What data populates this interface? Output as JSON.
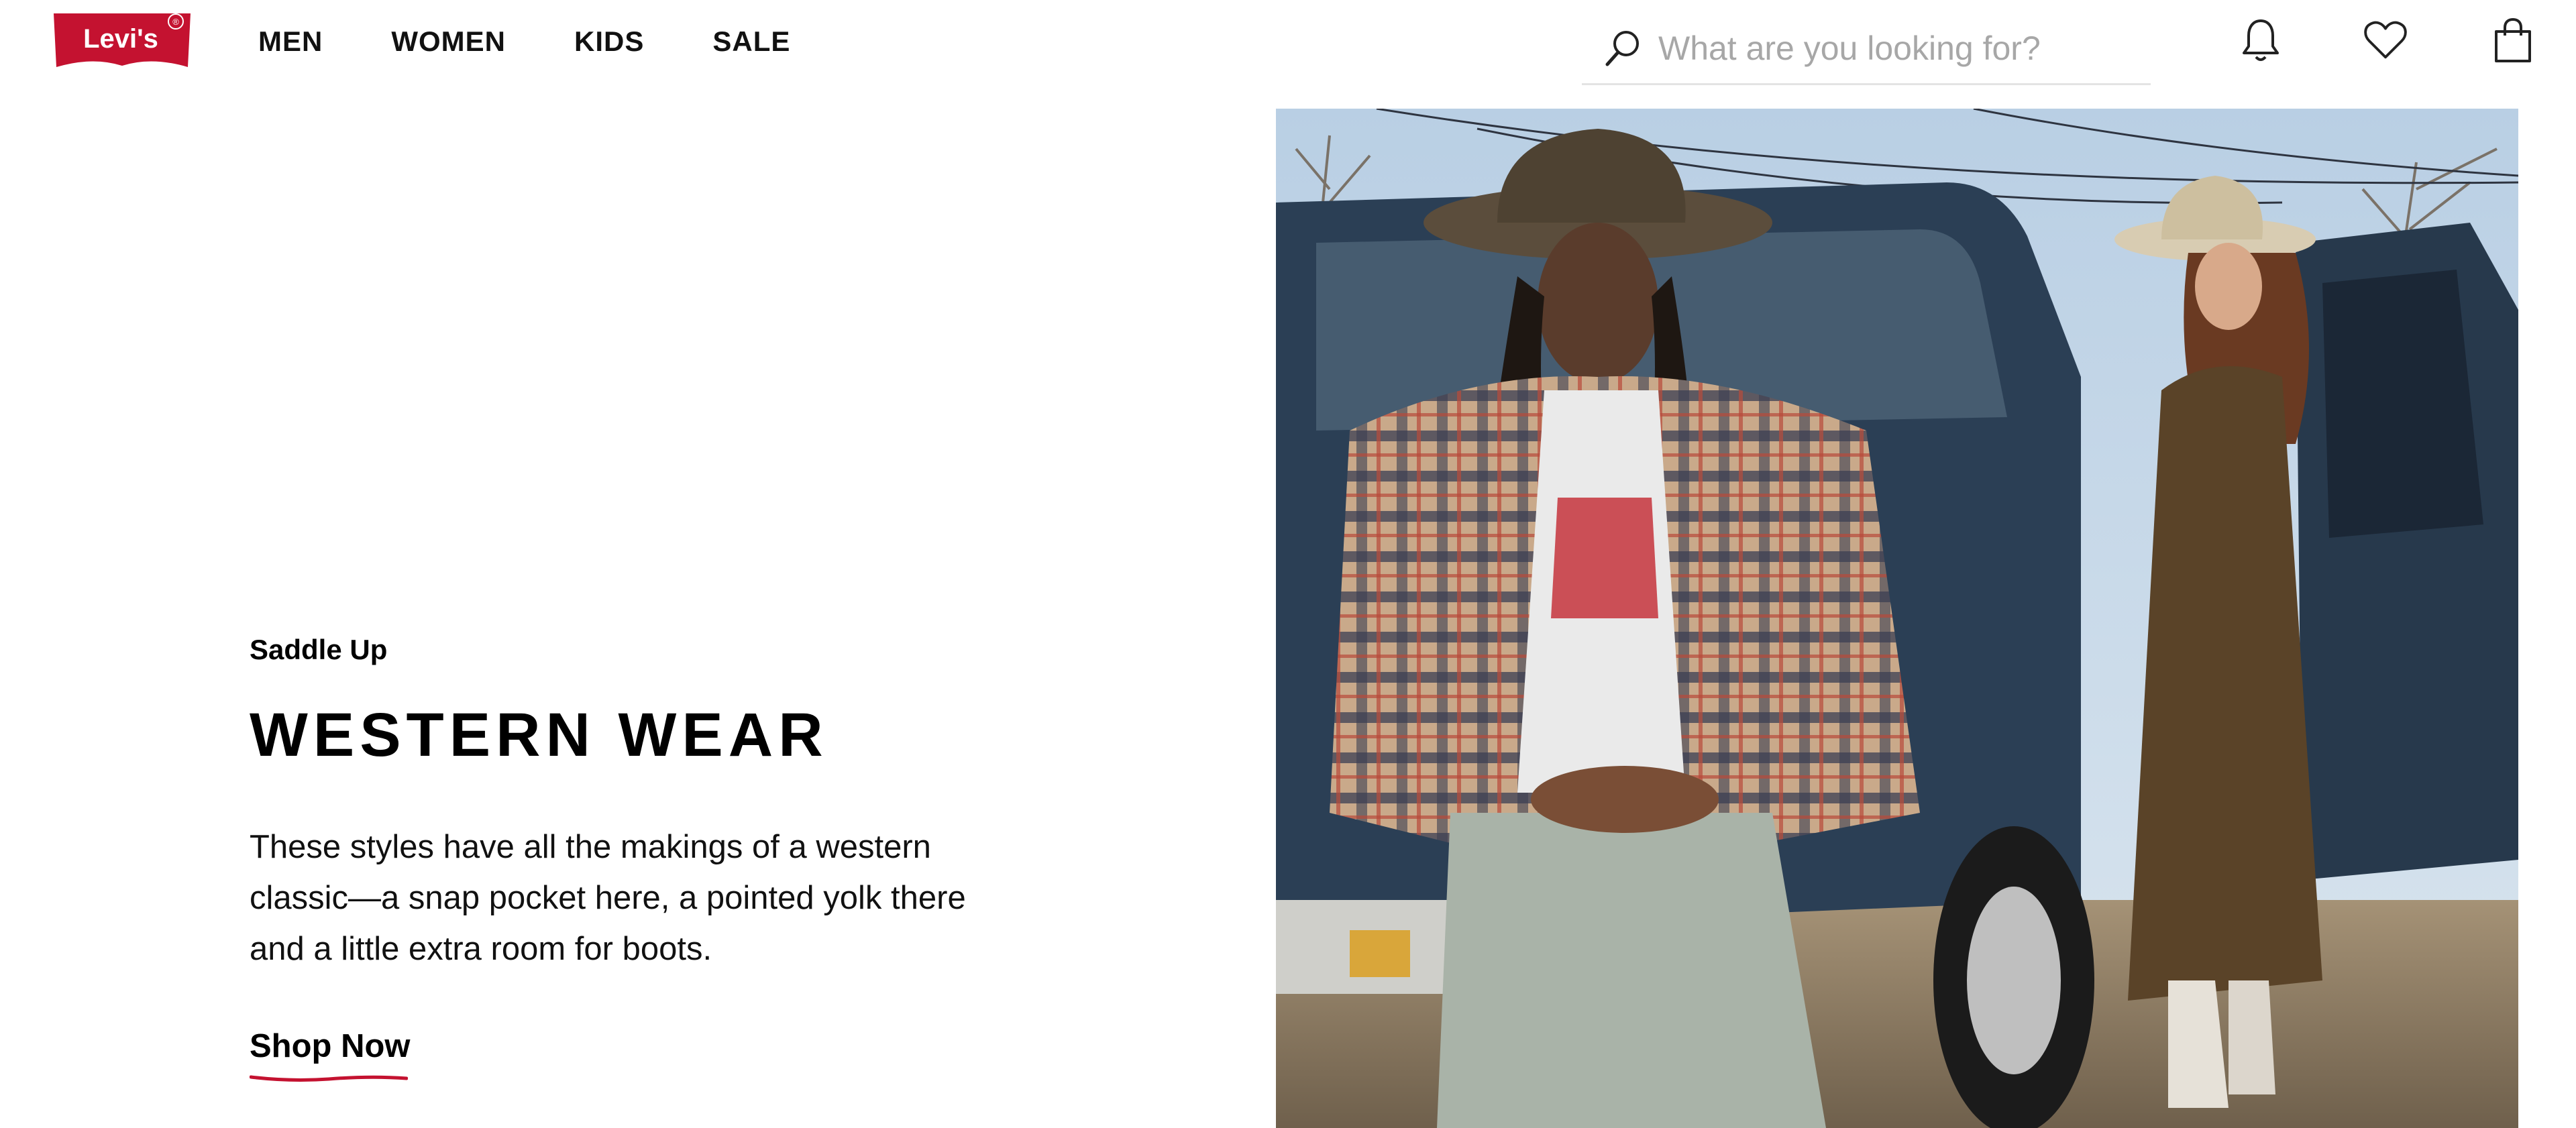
{
  "brand": {
    "logo_text": "Levi's",
    "registered": "®",
    "color": "#c41230"
  },
  "nav": {
    "items": [
      {
        "label": "MEN"
      },
      {
        "label": "WOMEN"
      },
      {
        "label": "KIDS"
      },
      {
        "label": "SALE"
      }
    ]
  },
  "search": {
    "placeholder": "What are you looking for?"
  },
  "header_icons": [
    "bell-icon",
    "heart-icon",
    "shopping-bag-icon"
  ],
  "hero": {
    "eyebrow": "Saddle Up",
    "headline": "WESTERN WEAR",
    "body": "These styles have all the makings of a western classic—a snap pocket here, a pointed yolk there and a little extra room for boots.",
    "cta": "Shop Now",
    "accent_color": "#c41230"
  }
}
